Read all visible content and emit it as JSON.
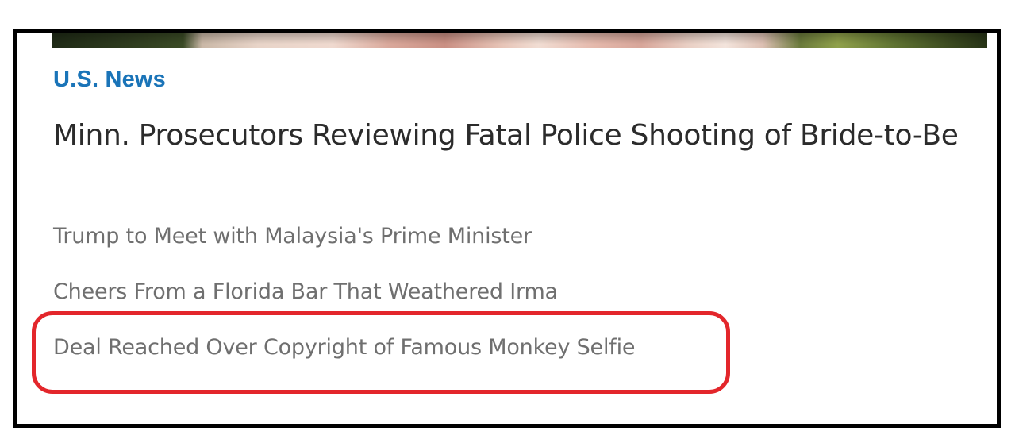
{
  "hero": {
    "image_name": "article-hero-image"
  },
  "section": {
    "label": "U.S. News"
  },
  "headline": {
    "text": "Minn. Prosecutors Reviewing Fatal Police Shooting of Bride-to-Be"
  },
  "related_stories": [
    {
      "title": "Trump to Meet with Malaysia's Prime Minister"
    },
    {
      "title": "Cheers From a Florida Bar That Weathered Irma"
    },
    {
      "title": "Deal Reached Over Copyright of Famous Monkey Selfie"
    }
  ],
  "annotation": {
    "color": "#e3262b",
    "highlighted_story_index": 2
  },
  "colors": {
    "section_label": "#1a74b8",
    "headline": "#2b2b2b",
    "story": "#6f6f6f",
    "border": "#000000"
  }
}
